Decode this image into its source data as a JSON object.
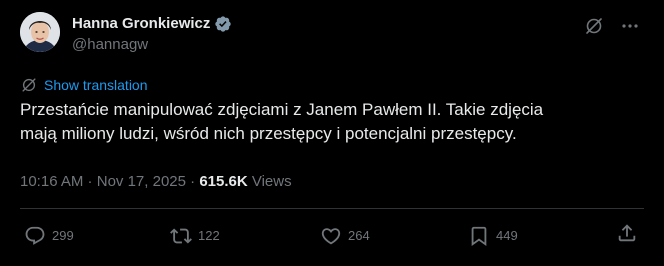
{
  "author": {
    "display_name": "Hanna Gronkiewicz",
    "handle": "@hannagw"
  },
  "translate": {
    "label": "Show translation"
  },
  "tweet": {
    "text_line1": "Przestańcie manipulować zdjęciami z Janem Pawłem II. Takie zdjęcia",
    "text_line2": "mają miliony ludzi, wśród nich przestępcy i potencjalni przestępcy."
  },
  "meta": {
    "time": "10:16 AM",
    "separator1": " · ",
    "date": "Nov 17, 2025",
    "separator2": " · ",
    "views_count": "615.6K",
    "views_label": " Views"
  },
  "actions": {
    "replies": "299",
    "reposts": "122",
    "likes": "264",
    "bookmarks": "449"
  },
  "colors": {
    "background": "#000000",
    "text": "#e7e9ea",
    "secondary": "#71767b",
    "accent": "#1d9bf0",
    "divider": "#2f3336"
  },
  "icons": [
    "verified-badge-icon",
    "grok-icon",
    "more-icon",
    "translate-icon",
    "reply-icon",
    "repost-icon",
    "like-icon",
    "bookmark-icon",
    "share-icon"
  ]
}
